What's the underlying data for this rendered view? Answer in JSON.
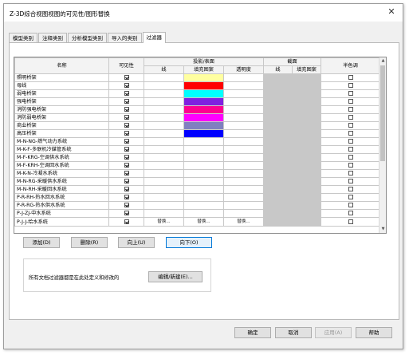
{
  "window": {
    "title": "Z-3D综合视图视图的可见性/图形替换",
    "close_glyph": "✕"
  },
  "tabs": [
    {
      "label": "模型类别",
      "active": false
    },
    {
      "label": "注释类别",
      "active": false
    },
    {
      "label": "分析模型类别",
      "active": false
    },
    {
      "label": "导入的类别",
      "active": false
    },
    {
      "label": "过滤器",
      "active": true
    }
  ],
  "grid": {
    "headers": {
      "name": "名称",
      "visibility": "可见性",
      "projection_surface": "投影/表面",
      "cut": "截面",
      "halftone": "半色调",
      "lines": "线",
      "fill_pattern": "填充图案",
      "transparency": "透明度",
      "cut_lines": "线",
      "cut_fill_pattern": "填充图案"
    },
    "override_label": "替换...",
    "rows": [
      {
        "name": "照明桥架",
        "visible": true,
        "fill": [
          "#ffffa0",
          "#ffffa0"
        ],
        "halftone": false
      },
      {
        "name": "母线",
        "visible": true,
        "fill": [
          "#ff0000",
          "#ff0000"
        ],
        "halftone": false
      },
      {
        "name": "弱电桥架",
        "visible": true,
        "fill": [
          "#00ffff",
          "#00ffff"
        ],
        "halftone": false
      },
      {
        "name": "强电桥架",
        "visible": true,
        "fill": [
          "#8020e0",
          "#8020e0"
        ],
        "halftone": false
      },
      {
        "name": "消防强电桥架",
        "visible": true,
        "fill": [
          "#ff0090",
          "#ff0090"
        ],
        "halftone": false
      },
      {
        "name": "消防弱电桥架",
        "visible": true,
        "fill": [
          "#ff00ff",
          "#ff00ff"
        ],
        "halftone": false
      },
      {
        "name": "商业桥架",
        "visible": true,
        "fill": [
          "#8080c0",
          "#8080c0"
        ],
        "halftone": false
      },
      {
        "name": "高压桥架",
        "visible": true,
        "fill": [
          "#0000ff",
          "#0000ff"
        ],
        "halftone": false
      },
      {
        "name": "M-N-NG-燃气动力系统",
        "visible": true,
        "fill": null,
        "halftone": false
      },
      {
        "name": "M-K-F-多联机冷媒管系统",
        "visible": true,
        "fill": null,
        "halftone": false
      },
      {
        "name": "M-F-KRG-空调供水系统",
        "visible": true,
        "fill": null,
        "halftone": false
      },
      {
        "name": "M-F-KRH-空调回水系统",
        "visible": true,
        "fill": null,
        "halftone": false
      },
      {
        "name": "M-K-N-冷凝水系统",
        "visible": true,
        "fill": null,
        "halftone": false
      },
      {
        "name": "M-N-RG-采暖供水系统",
        "visible": true,
        "fill": null,
        "halftone": false
      },
      {
        "name": "M-N-RH-采暖回水系统",
        "visible": true,
        "fill": null,
        "halftone": false
      },
      {
        "name": "P-R-RH-热水回水系统",
        "visible": true,
        "fill": null,
        "halftone": false
      },
      {
        "name": "P-R-RG-热水供水系统",
        "visible": true,
        "fill": null,
        "halftone": false
      },
      {
        "name": "P-J-ZJ-中水系统",
        "visible": true,
        "fill": null,
        "halftone": false
      },
      {
        "name": "P-J-J-给水系统",
        "visible": true,
        "fill": null,
        "halftone": false,
        "selected": true
      }
    ]
  },
  "row_buttons": {
    "add": "添加(D)",
    "remove": "删除(R)",
    "up": "向上(U)",
    "down": "向下(O)"
  },
  "info": {
    "text": "所有文档过滤器都是在此处定义和修改的",
    "edit_new": "编辑/新建(E)..."
  },
  "footer": {
    "ok": "确定",
    "cancel": "取消",
    "apply": "应用(A)",
    "help": "帮助"
  }
}
